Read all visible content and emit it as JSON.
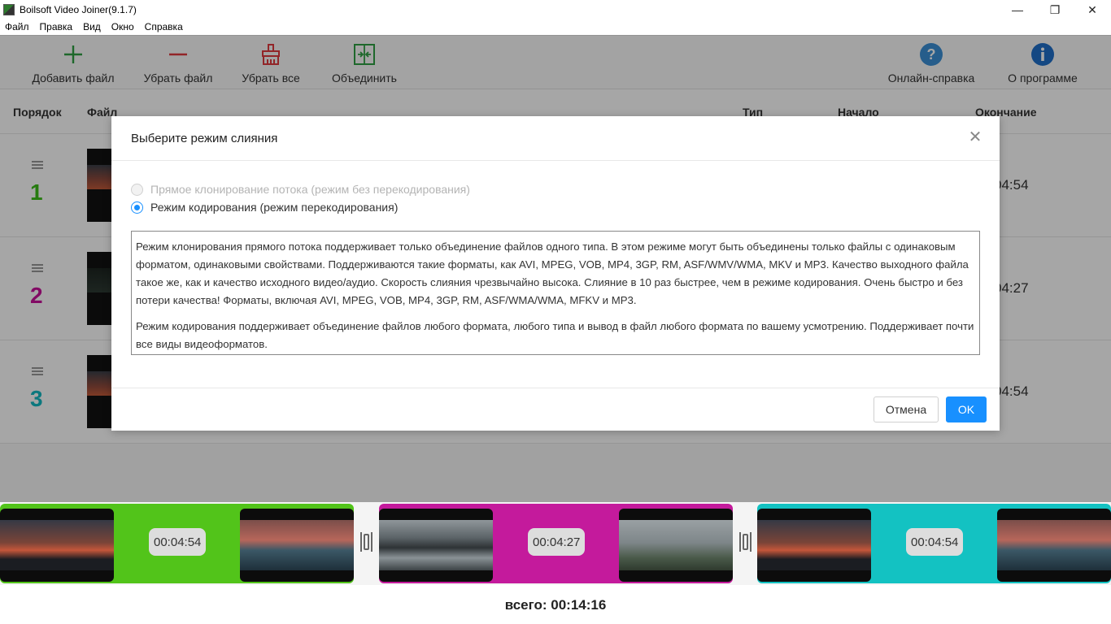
{
  "window": {
    "title": "Boilsoft Video Joiner(9.1.7)",
    "controls": {
      "minimize": "—",
      "restore": "❐",
      "close": "✕"
    }
  },
  "menu": [
    "Файл",
    "Правка",
    "Вид",
    "Окно",
    "Справка"
  ],
  "toolbar": {
    "add": "Добавить файл",
    "remove": "Убрать файл",
    "clear": "Убрать все",
    "join": "Объединить",
    "help": "Онлайн-справка",
    "about": "О программе"
  },
  "columns": {
    "order": "Порядок",
    "file": "Файл",
    "type": "Тип",
    "start": "Начало",
    "end": "Окончание"
  },
  "rows": [
    {
      "num": "1",
      "end": "04:54",
      "color": "#3cbe1a"
    },
    {
      "num": "2",
      "end": "04:27",
      "color": "#c8109a"
    },
    {
      "num": "3",
      "end": "04:54",
      "color": "#13b8c2"
    }
  ],
  "timeline": {
    "clips": [
      {
        "duration": "00:04:54",
        "color": "#52c41a"
      },
      {
        "duration": "00:04:27",
        "color": "#c41a9c"
      },
      {
        "duration": "00:04:54",
        "color": "#13c2c2"
      }
    ]
  },
  "total": "всего: 00:14:16",
  "dialog": {
    "title": "Выберите режим слияния",
    "close": "✕",
    "option_stream": "Прямое клонирование потока (режим без перекодирования)",
    "option_encode": "Режим кодирования (режим перекодирования)",
    "paragraph1": "Режим клонирования прямого потока поддерживает только объединение файлов одного типа. В этом режиме могут быть объединены только файлы с одинаковым форматом, одинаковыми свойствами. Поддерживаются такие форматы, как AVI, MPEG, VOB, MP4, 3GP, RM, ASF/WMV/WMA, MKV и MP3. Качество выходного файла такое же, как и качество исходного видео/аудио. Скорость слияния чрезвычайно высока. Слияние в 10 раз быстрее, чем в режиме кодирования. Очень быстро и без потери качества! Форматы, включая AVI, MPEG, VOB, MP4, 3GP, RM, ASF/WMA/WMA, MFKV и MP3.",
    "paragraph2": "Режим кодирования поддерживает объединение файлов любого формата, любого типа и вывод в файл любого формата по вашему усмотрению. Поддерживает почти все виды видеоформатов.",
    "cancel": "Отмена",
    "ok": "OK"
  },
  "colors": {
    "accent": "#1890ff",
    "add": "#2ea043",
    "remove": "#e0393e",
    "help": "#3b82c4",
    "about": "#1f6fb5"
  }
}
